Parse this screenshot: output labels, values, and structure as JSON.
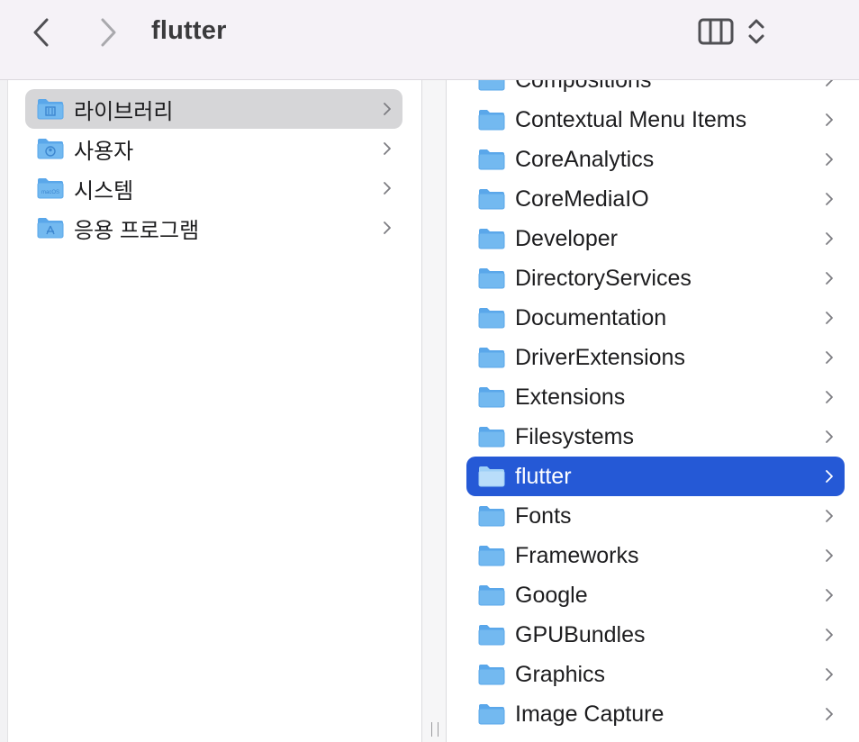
{
  "window": {
    "title": "flutter",
    "back_icon": "chevron-left-icon",
    "forward_icon": "chevron-right-icon",
    "view_icon": "column-view-icon",
    "view_menu_icon": "up-down-chevron-icon"
  },
  "colors": {
    "toolbar_bg": "#f5f2f7",
    "folder_blue": "#6fb6ee",
    "selected_gray": "#d6d6d8",
    "active_blue": "#2559d6"
  },
  "column1": {
    "items": [
      {
        "label": "라이브러리",
        "icon": "library-folder-icon",
        "selected": true
      },
      {
        "label": "사용자",
        "icon": "users-folder-icon"
      },
      {
        "label": "시스템",
        "icon": "system-folder-icon"
      },
      {
        "label": "응용 프로그램",
        "icon": "applications-folder-icon"
      }
    ]
  },
  "column2": {
    "items": [
      {
        "label": "Compositions"
      },
      {
        "label": "Contextual Menu Items"
      },
      {
        "label": "CoreAnalytics"
      },
      {
        "label": "CoreMediaIO"
      },
      {
        "label": "Developer"
      },
      {
        "label": "DirectoryServices"
      },
      {
        "label": "Documentation"
      },
      {
        "label": "DriverExtensions"
      },
      {
        "label": "Extensions"
      },
      {
        "label": "Filesystems"
      },
      {
        "label": "flutter",
        "active": true
      },
      {
        "label": "Fonts"
      },
      {
        "label": "Frameworks"
      },
      {
        "label": "Google"
      },
      {
        "label": "GPUBundles"
      },
      {
        "label": "Graphics"
      },
      {
        "label": "Image Capture"
      }
    ]
  }
}
